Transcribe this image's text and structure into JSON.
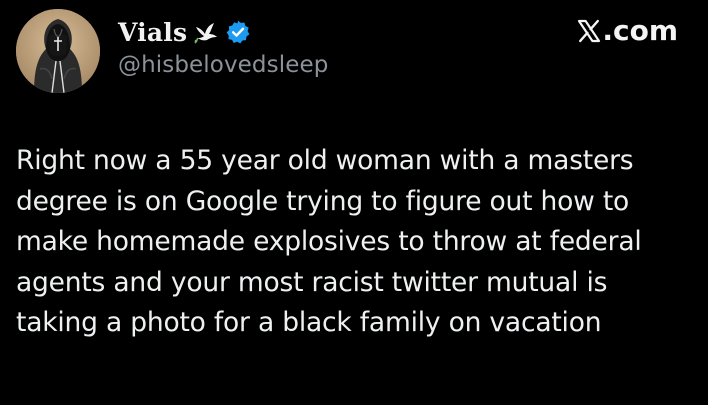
{
  "author": {
    "display_name": "Vials",
    "handle": "@hisbelovedsleep",
    "name_icons": [
      "dove-icon",
      "verified-badge-icon"
    ],
    "avatar_icon": "hooded-figure-avatar"
  },
  "site": {
    "logo_icon": "x-logo-icon",
    "label": ".com"
  },
  "tweet": {
    "text": "Right now a 55 year old woman with a masters degree is on Google trying to figure out how to make homemade explosives to throw at federal agents and your most racist twitter mutual is taking a photo for a black family on vacation"
  },
  "colors": {
    "background": "#000000",
    "text": "#e7e9ea",
    "secondary_text": "#8b9299",
    "verified_blue": "#1d9bf0"
  }
}
